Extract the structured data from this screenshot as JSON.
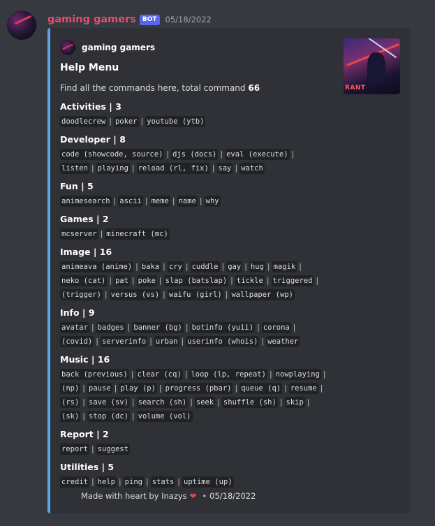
{
  "message": {
    "username": "gaming gamers",
    "bot_badge": "BOT",
    "timestamp": "05/18/2022"
  },
  "embed": {
    "accent_color": "#5aa5e6",
    "author": "gaming gamers",
    "title": "Help Menu",
    "description_prefix": "Find all the commands here, total command ",
    "description_total": "66",
    "thumbnail_text": "RANT",
    "fields": [
      {
        "name": "Activities | 3",
        "lines": [
          [
            "doodlecrew",
            "poker",
            "youtube (ytb)"
          ]
        ]
      },
      {
        "name": "Developer | 8",
        "lines": [
          [
            "code (showcode, source)",
            "djs (docs)",
            "eval (execute)"
          ],
          [
            "listen",
            "playing",
            "reload (rl, fix)",
            "say",
            "watch"
          ]
        ]
      },
      {
        "name": "Fun | 5",
        "lines": [
          [
            "animesearch",
            "ascii",
            "meme",
            "name",
            "why"
          ]
        ]
      },
      {
        "name": "Games | 2",
        "lines": [
          [
            "mcserver",
            "minecraft (mc)"
          ]
        ]
      },
      {
        "name": "Image | 16",
        "lines": [
          [
            "animeava (anime)",
            "baka",
            "cry",
            "cuddle",
            "gay",
            "hug",
            "magik"
          ],
          [
            "neko (cat)",
            "pat",
            "poke",
            "slap (batslap)",
            "tickle",
            "triggered"
          ],
          [
            "(trigger)",
            "versus (vs)",
            "waifu (girl)",
            "wallpaper (wp)"
          ]
        ]
      },
      {
        "name": "Info | 9",
        "lines": [
          [
            "avatar",
            "badges",
            "banner (bg)",
            "botinfo (yuii)",
            "corona"
          ],
          [
            "(covid)",
            "serverinfo",
            "urban",
            "userinfo (whois)",
            "weather"
          ]
        ]
      },
      {
        "name": "Music | 16",
        "lines": [
          [
            "back (previous)",
            "clear (cq)",
            "loop (lp, repeat)",
            "nowplaying"
          ],
          [
            "(np)",
            "pause",
            "play (p)",
            "progress (pbar)",
            "queue (q)",
            "resume"
          ],
          [
            "(rs)",
            "save (sv)",
            "search (sh)",
            "seek",
            "shuffle (sh)",
            "skip"
          ],
          [
            "(sk)",
            "stop (dc)",
            "volume (vol)"
          ]
        ]
      },
      {
        "name": "Report | 2",
        "lines": [
          [
            "report",
            "suggest"
          ]
        ]
      },
      {
        "name": "Utilities | 5",
        "lines": [
          [
            "credit",
            "help",
            "ping",
            "stats",
            "uptime (up)"
          ]
        ]
      }
    ],
    "footer": {
      "text": "Made with heart by Inazys",
      "heart": "❤",
      "separator": "•",
      "date": "05/18/2022"
    }
  }
}
